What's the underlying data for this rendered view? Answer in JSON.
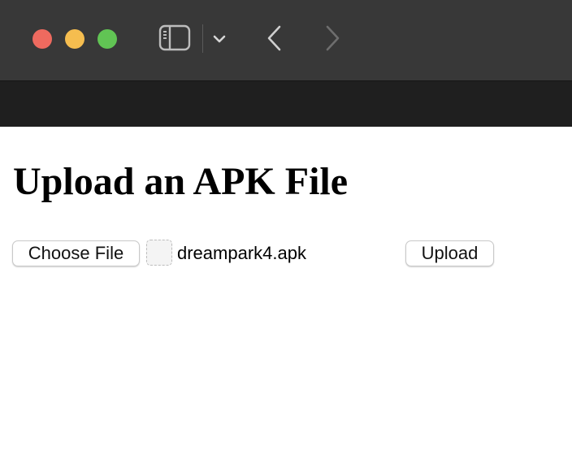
{
  "window": {
    "traffic_lights": {
      "close_color": "#ee6a5f",
      "minimize_color": "#f5bd4f",
      "zoom_color": "#61c454"
    },
    "toolbar": {
      "sidebar_icon": "sidebar-icon",
      "dropdown_icon": "chevron-down-icon",
      "back_icon": "chevron-left-icon",
      "forward_icon": "chevron-right-icon"
    }
  },
  "page": {
    "title": "Upload an APK File",
    "form": {
      "choose_file_label": "Choose File",
      "selected_file_name": "dreampark4.apk",
      "upload_label": "Upload"
    }
  }
}
